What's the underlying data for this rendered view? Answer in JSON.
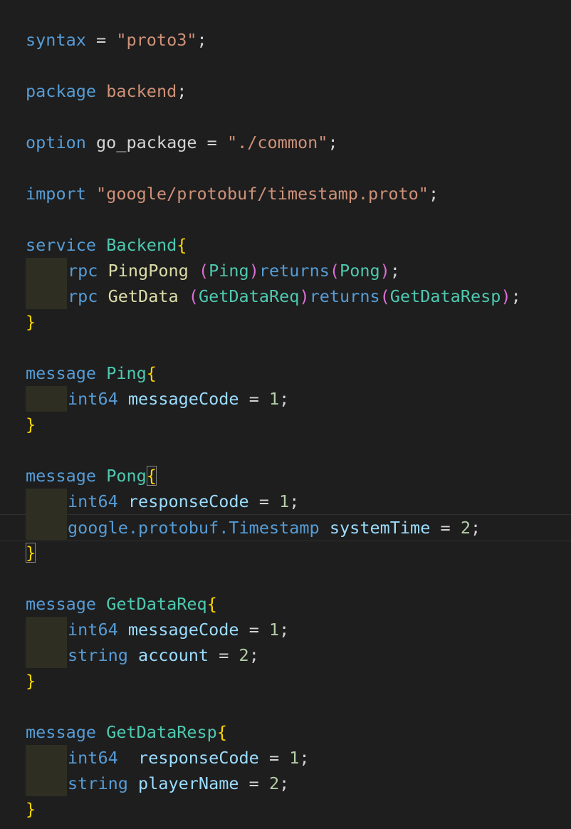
{
  "editor": {
    "language": "proto",
    "colors": {
      "background": "#1e1e1e",
      "keyword": "#569cd6",
      "string": "#ce9178",
      "type": "#4ec9b0",
      "function": "#dcdcaa",
      "field": "#9cdcfe",
      "number": "#b5cea8",
      "brace": "#ffd700",
      "paren": "#da70d6",
      "indent_guide": "#2e2e22"
    },
    "lines": [
      [],
      [
        {
          "t": "syntax",
          "c": "keyword"
        },
        {
          "t": " = ",
          "c": "punct"
        },
        {
          "t": "\"proto3\"",
          "c": "string"
        },
        {
          "t": ";",
          "c": "punct"
        }
      ],
      [],
      [
        {
          "t": "package",
          "c": "keyword"
        },
        {
          "t": " ",
          "c": "punct"
        },
        {
          "t": "backend",
          "c": "string"
        },
        {
          "t": ";",
          "c": "punct"
        }
      ],
      [],
      [
        {
          "t": "option",
          "c": "keyword"
        },
        {
          "t": " go_package = ",
          "c": "plain"
        },
        {
          "t": "\"./common\"",
          "c": "string"
        },
        {
          "t": ";",
          "c": "punct"
        }
      ],
      [],
      [
        {
          "t": "import",
          "c": "keyword"
        },
        {
          "t": " ",
          "c": "punct"
        },
        {
          "t": "\"google/protobuf/timestamp.proto\"",
          "c": "string"
        },
        {
          "t": ";",
          "c": "punct"
        }
      ],
      [],
      [
        {
          "t": "service",
          "c": "keyword"
        },
        {
          "t": " ",
          "c": "punct"
        },
        {
          "t": "Backend",
          "c": "type"
        },
        {
          "t": "{",
          "c": "brace"
        }
      ],
      [
        {
          "t": "rpc",
          "c": "keyword"
        },
        {
          "t": " ",
          "c": "punct"
        },
        {
          "t": "PingPong",
          "c": "func"
        },
        {
          "t": " (",
          "c": "paren"
        },
        {
          "t": "Ping",
          "c": "type"
        },
        {
          "t": ")",
          "c": "paren"
        },
        {
          "t": "returns",
          "c": "keyword"
        },
        {
          "t": "(",
          "c": "paren"
        },
        {
          "t": "Pong",
          "c": "type"
        },
        {
          "t": ")",
          "c": "paren"
        },
        {
          "t": ";",
          "c": "punct"
        }
      ],
      [
        {
          "t": "rpc",
          "c": "keyword"
        },
        {
          "t": " ",
          "c": "punct"
        },
        {
          "t": "GetData",
          "c": "func"
        },
        {
          "t": " (",
          "c": "paren"
        },
        {
          "t": "GetDataReq",
          "c": "type"
        },
        {
          "t": ")",
          "c": "paren"
        },
        {
          "t": "returns",
          "c": "keyword"
        },
        {
          "t": "(",
          "c": "paren"
        },
        {
          "t": "GetDataResp",
          "c": "type"
        },
        {
          "t": ")",
          "c": "paren"
        },
        {
          "t": ";",
          "c": "punct"
        }
      ],
      [
        {
          "t": "}",
          "c": "brace"
        }
      ],
      [],
      [
        {
          "t": "message",
          "c": "keyword"
        },
        {
          "t": " ",
          "c": "punct"
        },
        {
          "t": "Ping",
          "c": "type"
        },
        {
          "t": "{",
          "c": "brace"
        }
      ],
      [
        {
          "t": "int64",
          "c": "keyword"
        },
        {
          "t": " ",
          "c": "punct"
        },
        {
          "t": "messageCode",
          "c": "field"
        },
        {
          "t": " = ",
          "c": "punct"
        },
        {
          "t": "1",
          "c": "number"
        },
        {
          "t": ";",
          "c": "punct"
        }
      ],
      [
        {
          "t": "}",
          "c": "brace"
        }
      ],
      [],
      [
        {
          "t": "message",
          "c": "keyword"
        },
        {
          "t": " ",
          "c": "punct"
        },
        {
          "t": "Pong",
          "c": "type"
        },
        {
          "t": "{",
          "c": "brace"
        }
      ],
      [
        {
          "t": "int64",
          "c": "keyword"
        },
        {
          "t": " ",
          "c": "punct"
        },
        {
          "t": "responseCode",
          "c": "field"
        },
        {
          "t": " = ",
          "c": "punct"
        },
        {
          "t": "1",
          "c": "number"
        },
        {
          "t": ";",
          "c": "punct"
        }
      ],
      [
        {
          "t": "google.protobuf.Timestamp",
          "c": "keyword"
        },
        {
          "t": " ",
          "c": "punct"
        },
        {
          "t": "systemTime",
          "c": "field"
        },
        {
          "t": " = ",
          "c": "punct"
        },
        {
          "t": "2",
          "c": "number"
        },
        {
          "t": ";",
          "c": "punct"
        }
      ],
      [
        {
          "t": "}",
          "c": "brace"
        }
      ],
      [],
      [
        {
          "t": "message",
          "c": "keyword"
        },
        {
          "t": " ",
          "c": "punct"
        },
        {
          "t": "GetDataReq",
          "c": "type"
        },
        {
          "t": "{",
          "c": "brace"
        }
      ],
      [
        {
          "t": "int64",
          "c": "keyword"
        },
        {
          "t": " ",
          "c": "punct"
        },
        {
          "t": "messageCode",
          "c": "field"
        },
        {
          "t": " = ",
          "c": "punct"
        },
        {
          "t": "1",
          "c": "number"
        },
        {
          "t": ";",
          "c": "punct"
        }
      ],
      [
        {
          "t": "string",
          "c": "keyword"
        },
        {
          "t": " ",
          "c": "punct"
        },
        {
          "t": "account",
          "c": "field"
        },
        {
          "t": " = ",
          "c": "punct"
        },
        {
          "t": "2",
          "c": "number"
        },
        {
          "t": ";",
          "c": "punct"
        }
      ],
      [
        {
          "t": "}",
          "c": "brace"
        }
      ],
      [],
      [
        {
          "t": "message",
          "c": "keyword"
        },
        {
          "t": " ",
          "c": "punct"
        },
        {
          "t": "GetDataResp",
          "c": "type"
        },
        {
          "t": "{",
          "c": "brace"
        }
      ],
      [
        {
          "t": "int64",
          "c": "keyword"
        },
        {
          "t": "  ",
          "c": "punct"
        },
        {
          "t": "responseCode",
          "c": "field"
        },
        {
          "t": " = ",
          "c": "punct"
        },
        {
          "t": "1",
          "c": "number"
        },
        {
          "t": ";",
          "c": "punct"
        }
      ],
      [
        {
          "t": "string",
          "c": "keyword"
        },
        {
          "t": " ",
          "c": "punct"
        },
        {
          "t": "playerName",
          "c": "field"
        },
        {
          "t": " = ",
          "c": "punct"
        },
        {
          "t": "2",
          "c": "number"
        },
        {
          "t": ";",
          "c": "punct"
        }
      ],
      [
        {
          "t": "}",
          "c": "brace"
        }
      ]
    ]
  }
}
